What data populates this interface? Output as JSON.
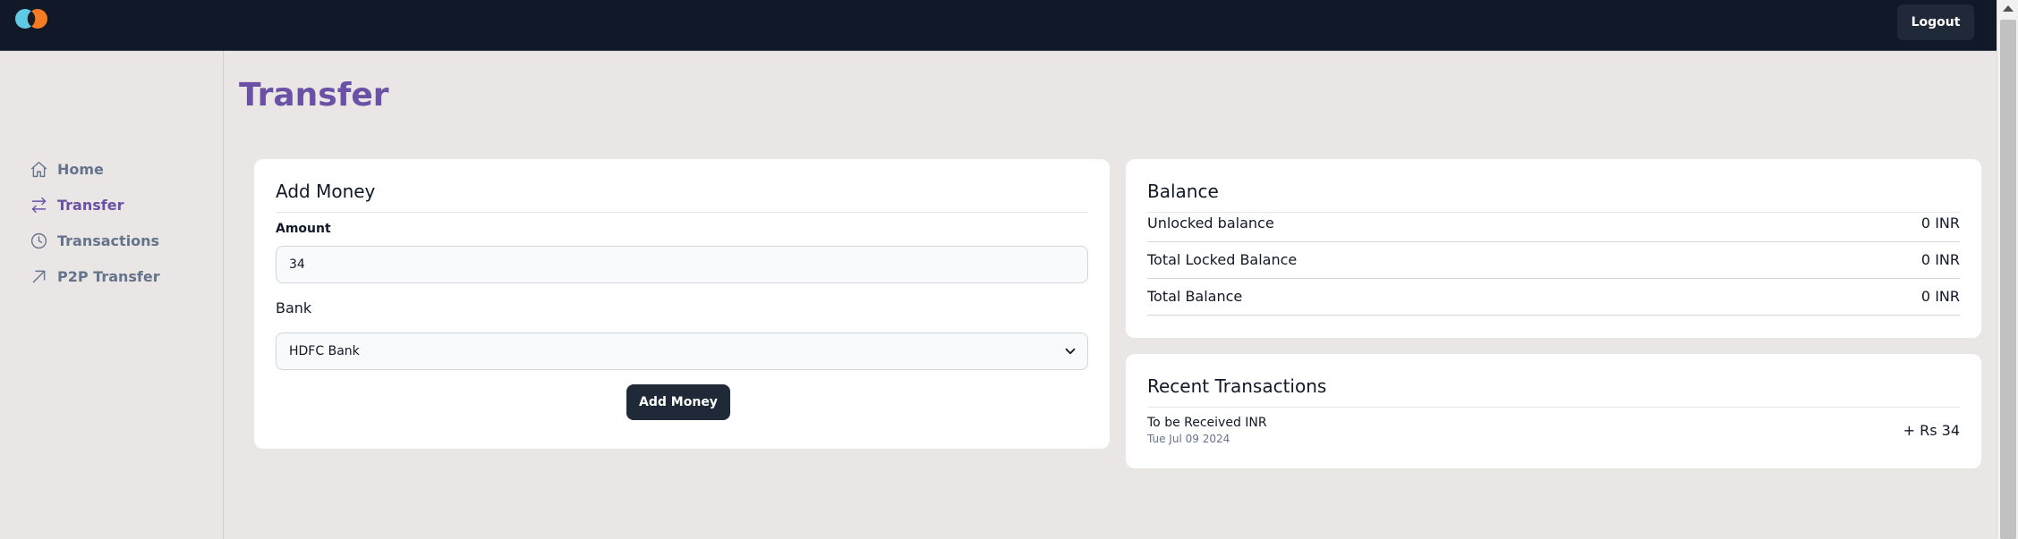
{
  "topbar": {
    "logout_label": "Logout"
  },
  "sidebar": {
    "items": [
      {
        "label": "Home",
        "icon": "home-icon"
      },
      {
        "label": "Transfer",
        "icon": "transfer-icon",
        "active": true
      },
      {
        "label": "Transactions",
        "icon": "clock-icon"
      },
      {
        "label": "P2P Transfer",
        "icon": "arrow-up-right-icon"
      }
    ]
  },
  "main": {
    "title": "Transfer"
  },
  "add_money": {
    "title": "Add Money",
    "amount_label": "Amount",
    "amount_value": "34",
    "bank_label": "Bank",
    "bank_selected": "HDFC Bank",
    "button_label": "Add Money"
  },
  "balance": {
    "title": "Balance",
    "rows": [
      {
        "label": "Unlocked balance",
        "value": "0 INR"
      },
      {
        "label": "Total Locked Balance",
        "value": "0 INR"
      },
      {
        "label": "Total Balance",
        "value": "0 INR"
      }
    ]
  },
  "recent_transactions": {
    "title": "Recent Transactions",
    "items": [
      {
        "title": "To be Received INR",
        "date": "Tue Jul 09 2024",
        "amount": "+ Rs 34"
      }
    ]
  },
  "colors": {
    "accent": "#6a51a6",
    "topbar": "#111827",
    "background": "#ebe6e6",
    "button": "#1f2937"
  }
}
